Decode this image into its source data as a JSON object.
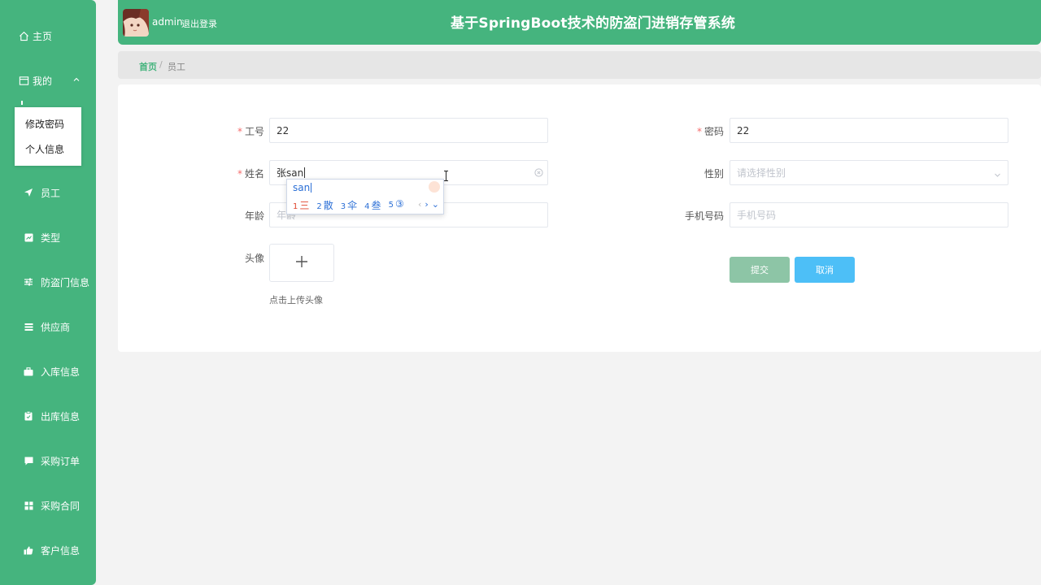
{
  "header": {
    "username": "admin",
    "logout": "退出登录",
    "title": "基于SpringBoot技术的防盗门进销存管系统"
  },
  "sidebar": {
    "home": "主页",
    "mine": "我的",
    "submenu": [
      "修改密码",
      "个人信息"
    ],
    "items": [
      {
        "label": "员工",
        "icon": "send-icon"
      },
      {
        "label": "类型",
        "icon": "chart-icon"
      },
      {
        "label": "防盗门信息",
        "icon": "sliders-icon"
      },
      {
        "label": "供应商",
        "icon": "list-icon"
      },
      {
        "label": "入库信息",
        "icon": "briefcase-icon"
      },
      {
        "label": "出库信息",
        "icon": "clipboard-icon"
      },
      {
        "label": "采购订单",
        "icon": "comment-icon"
      },
      {
        "label": "采购合同",
        "icon": "grid-icon"
      },
      {
        "label": "客户信息",
        "icon": "thumb-icon"
      }
    ]
  },
  "breadcrumb": {
    "home": "首页",
    "separator": "/",
    "current": "员工"
  },
  "form": {
    "employee_no_label": "工号",
    "employee_no_value": "22",
    "password_label": "密码",
    "password_value": "22",
    "name_label": "姓名",
    "name_value": "张san",
    "gender_label": "性别",
    "gender_placeholder": "请选择性别",
    "age_label": "年龄",
    "age_placeholder": "年龄",
    "phone_label": "手机号码",
    "phone_placeholder": "手机号码",
    "avatar_label": "头像",
    "upload_hint": "点击上传头像",
    "submit": "提交",
    "cancel": "取消"
  },
  "ime": {
    "composition": "san",
    "candidates": [
      {
        "num": "1",
        "text": "三"
      },
      {
        "num": "2",
        "text": "散"
      },
      {
        "num": "3",
        "text": "伞"
      },
      {
        "num": "4",
        "text": "叁"
      },
      {
        "num": "5",
        "text": "③"
      }
    ]
  },
  "colors": {
    "brand": "#45b47e",
    "cancel": "#4dbff7",
    "submit": "#8dc5a6",
    "required": "#f56c6c"
  }
}
